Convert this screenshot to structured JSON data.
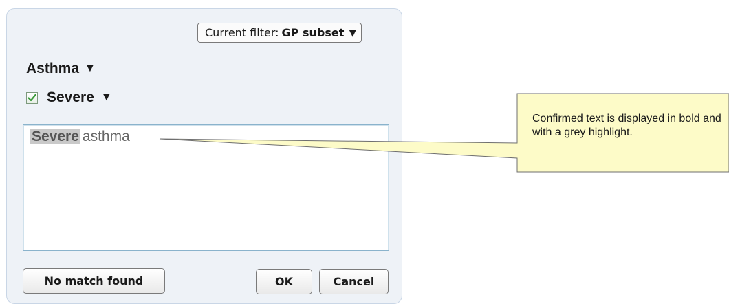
{
  "filter": {
    "prefix": "Current filter:",
    "value": "GP subset",
    "arrow": "▼"
  },
  "concept": {
    "heading": "Asthma",
    "heading_arrow": "▼",
    "qualifier": "Severe",
    "qualifier_arrow": "▼",
    "qualifier_checked": true
  },
  "text_area": {
    "confirmed_text": "Severe",
    "remaining_text": "asthma"
  },
  "buttons": {
    "no_match": "No match found",
    "ok": "OK",
    "cancel": "Cancel"
  },
  "callout": {
    "text": "Confirmed text is displayed in bold and with a grey highlight.",
    "fill_color": "#fdfbc8"
  },
  "colors": {
    "panel_background": "#eef2f7",
    "highlight_grey": "#c9c9c9",
    "checkbox_check": "#3a9a3a"
  },
  "icons": {
    "checkbox": "checkmark-icon",
    "dropdown": "triangle-down-icon"
  }
}
